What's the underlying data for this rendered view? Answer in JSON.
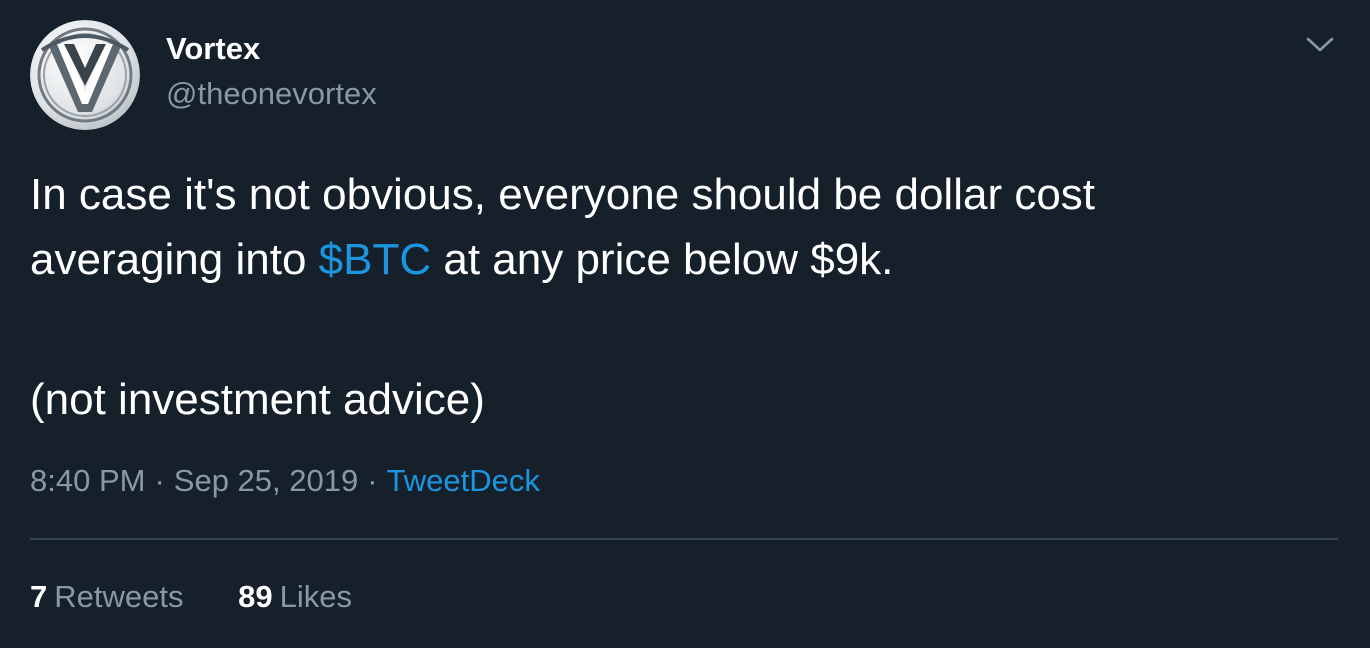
{
  "tweet": {
    "author": {
      "display_name": "Vortex",
      "handle": "@theonevortex",
      "avatar_icon": "vortex-logo-avatar"
    },
    "menu_icon": "chevron-down-icon",
    "text": {
      "line1": "In case it's not obvious, everyone should be dollar cost",
      "line2_before": "averaging into ",
      "cashtag": "$BTC",
      "line2_after": " at any price below $9k.",
      "line3": "(not investment advice)"
    },
    "meta": {
      "time": "8:40 PM",
      "separator1": "·",
      "date": "Sep 25, 2019",
      "separator2": "·",
      "source": "TweetDeck"
    },
    "stats": {
      "retweets_count": "7",
      "retweets_label": "Retweets",
      "likes_count": "89",
      "likes_label": "Likes"
    },
    "colors": {
      "background": "#15202b",
      "text_primary": "#ffffff",
      "text_secondary": "#8899a6",
      "link": "#1b95e0",
      "divider": "#38444d"
    }
  }
}
